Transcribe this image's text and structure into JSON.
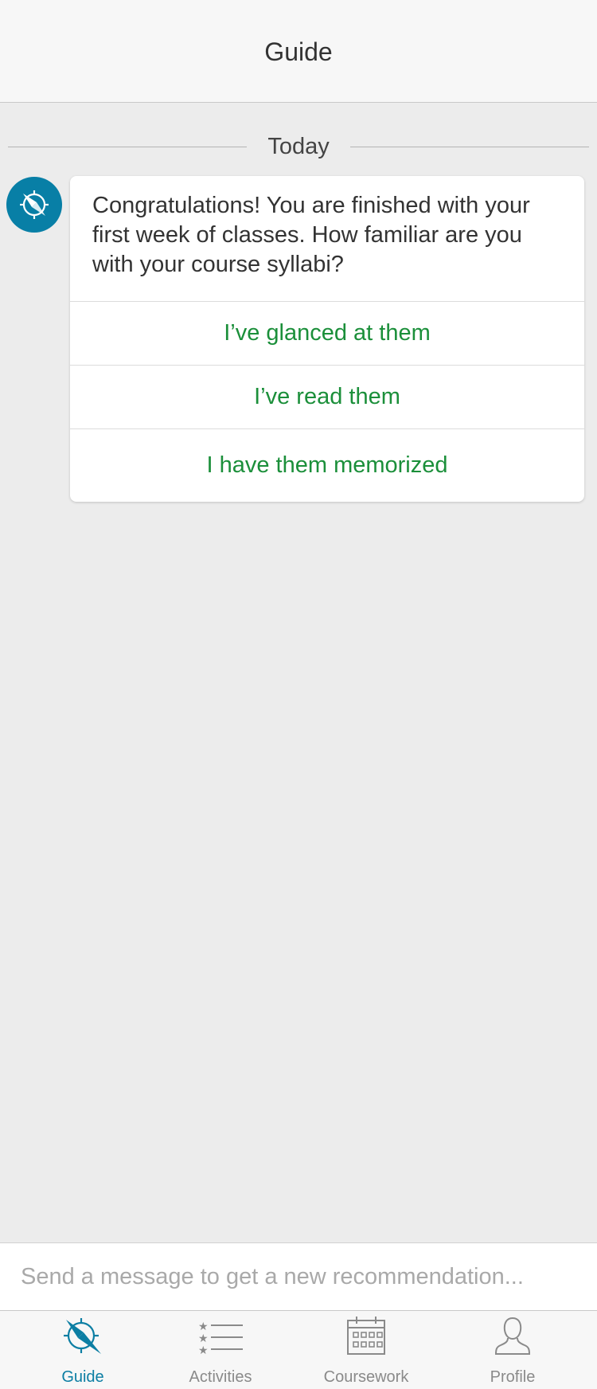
{
  "header": {
    "title": "Guide"
  },
  "chat": {
    "date_separator": "Today",
    "bot_avatar_icon": "compass-icon",
    "message": "Congratulations! You are finished with your first week of classes. How familiar are you with your course syllabi?",
    "options": [
      "I’ve glanced at them",
      "I’ve read them",
      "I have them memorized"
    ]
  },
  "composer": {
    "placeholder": "Send a message to get a new recommendation..."
  },
  "tabbar": {
    "active": "Guide",
    "tabs": [
      {
        "label": "Guide",
        "icon": "compass-icon"
      },
      {
        "label": "Activities",
        "icon": "list-icon"
      },
      {
        "label": "Coursework",
        "icon": "calendar-icon"
      },
      {
        "label": "Profile",
        "icon": "person-icon"
      }
    ]
  },
  "colors": {
    "accent": "#087fa6",
    "option_text": "#1b8f3a",
    "background": "#ececec"
  }
}
